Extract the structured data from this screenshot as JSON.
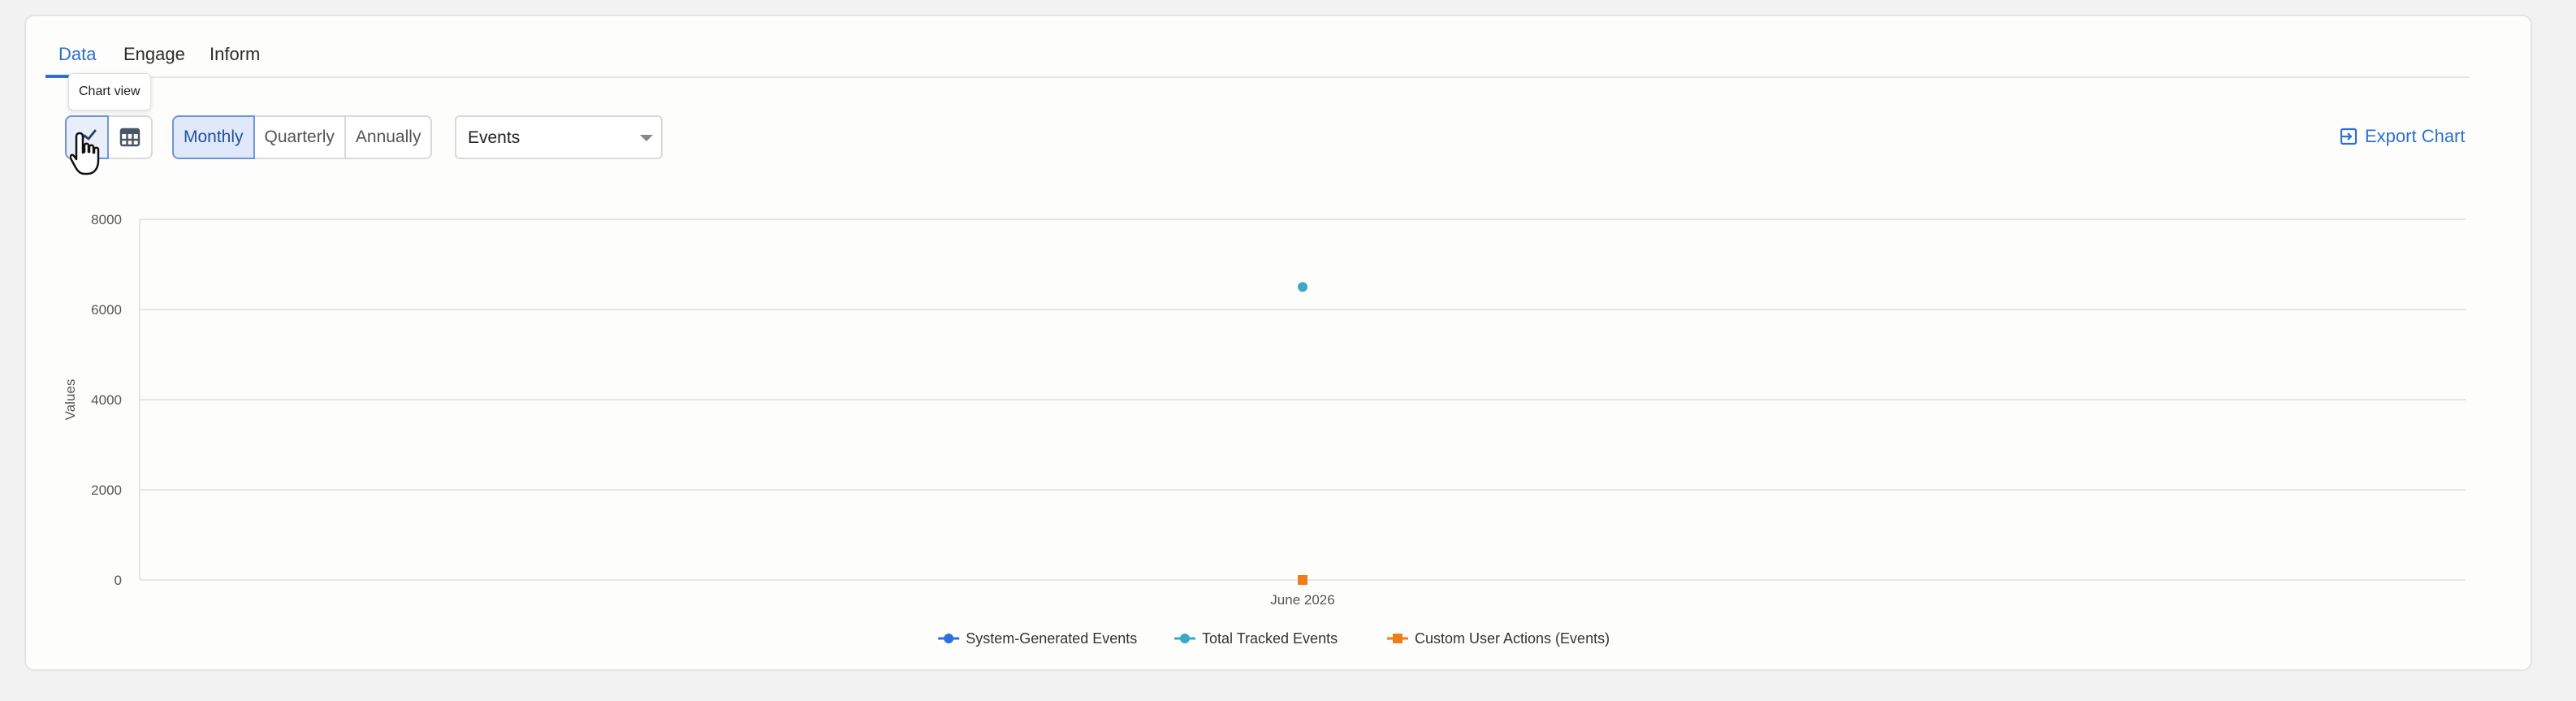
{
  "tabs": [
    {
      "label": "Data",
      "active": true
    },
    {
      "label": "Engage",
      "active": false
    },
    {
      "label": "Inform",
      "active": false
    }
  ],
  "toolbar": {
    "tooltip": "Chart view",
    "view_options": [
      {
        "icon": "line-chart-icon",
        "active": true
      },
      {
        "icon": "table-icon",
        "active": false
      }
    ],
    "periods": [
      {
        "label": "Monthly",
        "active": true
      },
      {
        "label": "Quarterly",
        "active": false
      },
      {
        "label": "Annually",
        "active": false
      }
    ],
    "metric_select": {
      "value": "Events"
    },
    "export_label": "Export Chart",
    "export_icon": "export-icon"
  },
  "colors": {
    "accent": "#2f6fd1",
    "system_generated": "#2c6fe0",
    "total_tracked": "#3aa9c4",
    "custom_user_actions": "#f07d1a"
  },
  "chart_data": {
    "type": "line",
    "categories": [
      "June 2026"
    ],
    "series": [
      {
        "name": "System-Generated Events",
        "values": [
          null
        ],
        "color": "#2c6fe0",
        "marker": "circle"
      },
      {
        "name": "Total Tracked Events",
        "values": [
          6500
        ],
        "color": "#3aa9c4",
        "marker": "circle"
      },
      {
        "name": "Custom User Actions (Events)",
        "values": [
          0
        ],
        "color": "#f07d1a",
        "marker": "square"
      }
    ],
    "yticks": [
      0,
      2000,
      4000,
      6000,
      8000
    ],
    "ylim": [
      0,
      8000
    ],
    "xlabel": "",
    "ylabel": "Values",
    "grid": true,
    "legend": "bottom-center"
  }
}
